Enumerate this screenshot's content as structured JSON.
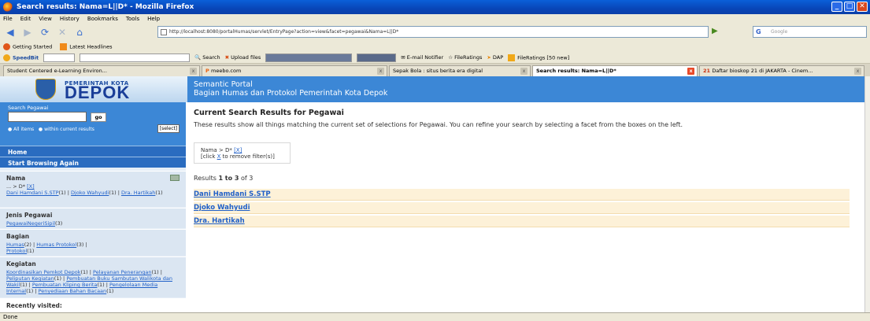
{
  "window": {
    "title": "Search results: Nama=L||D* - Mozilla Firefox"
  },
  "menu": [
    "File",
    "Edit",
    "View",
    "History",
    "Bookmarks",
    "Tools",
    "Help"
  ],
  "nav": {
    "url": "http://localhost:8080/portalHumas/servlet/EntryPage?action=view&facet=pegawai&Nama=L||D*",
    "search_placeholder": "Google"
  },
  "bookmarks": [
    "Getting Started",
    "Latest Headlines"
  ],
  "toolbar2": {
    "speedbit": "SpeedBit",
    "search": "Search",
    "upload": "Upload files",
    "email": "E-mail Notifier",
    "fileratings": "FileRatings",
    "dap": "DAP",
    "fileratings_new": "FileRatings [50 new]"
  },
  "tabs": [
    {
      "label": "Student Centered e-Learning Environ..."
    },
    {
      "label": "meebo.com"
    },
    {
      "label": "Sepak Bola : situs berita era digital"
    },
    {
      "label": "Search results: Nama=L||D*"
    },
    {
      "label": "Daftar bioskop 21 di JAKARTA - Cinem..."
    }
  ],
  "header": {
    "logo_small": "PEMERINTAH KOTA",
    "logo_big": "DEPOK",
    "title": "Semantic Portal",
    "subtitle": "Bagian Humas dan Protokol Pemerintah Kota Depok"
  },
  "sidebar": {
    "search_label": "Search Pegawai",
    "go": "go",
    "radio_all": "All items",
    "radio_within": "within current results",
    "select_label": "[select]",
    "home": "Home",
    "start": "Start Browsing Again",
    "facets": [
      {
        "title": "Nama",
        "values": [
          {
            "text": "... > D* ",
            "link": "[X]"
          },
          {
            "text": "Dani Hamdani S.STP",
            "count": "(1) | "
          },
          {
            "text": "Djoko Wahyudi",
            "count": "(1) | "
          },
          {
            "text": "Dra. Hartikah",
            "count": "(1)"
          }
        ]
      },
      {
        "title": "Jenis Pegawai",
        "values": [
          {
            "text": "PegawaiNegeriSipil",
            "count": "(3)"
          }
        ]
      },
      {
        "title": "Bagian",
        "values": [
          {
            "text": "Humas",
            "count": "(2) | "
          },
          {
            "text": "Humas Protokol",
            "count": "(3) | "
          },
          {
            "text": "Protokol",
            "count": "(1)"
          }
        ]
      },
      {
        "title": "Kegiatan",
        "values": [
          {
            "text": "Koordinasikan Pemkot Depok",
            "count": "(1) | "
          },
          {
            "text": "Pelayanan Penerangan",
            "count": "(1) | "
          },
          {
            "text": "Peliputan Kegiatan",
            "count": "(1) | "
          },
          {
            "text": "Pembuatan Buku Sambutan Walikota dan Wakil",
            "count": "(1) | "
          },
          {
            "text": "Pembuatan Kliping Berita",
            "count": "(1) | "
          },
          {
            "text": "Pengelolaan Media Internal",
            "count": "(1) | "
          },
          {
            "text": "Penyediaan Bahan Bacaan",
            "count": "(1)"
          }
        ]
      }
    ],
    "recent": "Recently visited:"
  },
  "main": {
    "heading": "Current Search Results for Pegawai",
    "intro": "These results show all things matching the current set of selections for Pegawai. You can refine your search by selecting a facet from the boxes on the left.",
    "filter_line": "Nama > D* ",
    "filter_x": "[X]",
    "filter_hint_pre": "[click ",
    "filter_hint_x": "X",
    "filter_hint_post": " to remove filter(s)]",
    "results_pre": "Results ",
    "results_range": "1 to 3",
    "results_post": " of 3",
    "results": [
      "Dani Hamdani S.STP",
      "Djoko Wahyudi",
      "Dra. Hartikah"
    ]
  },
  "status": "Done",
  "colors": {
    "header_blue": "#3c87d6",
    "sidebar_bg": "#dbe6f2",
    "result_bg": "#fdf1d8",
    "link": "#2060c8"
  }
}
